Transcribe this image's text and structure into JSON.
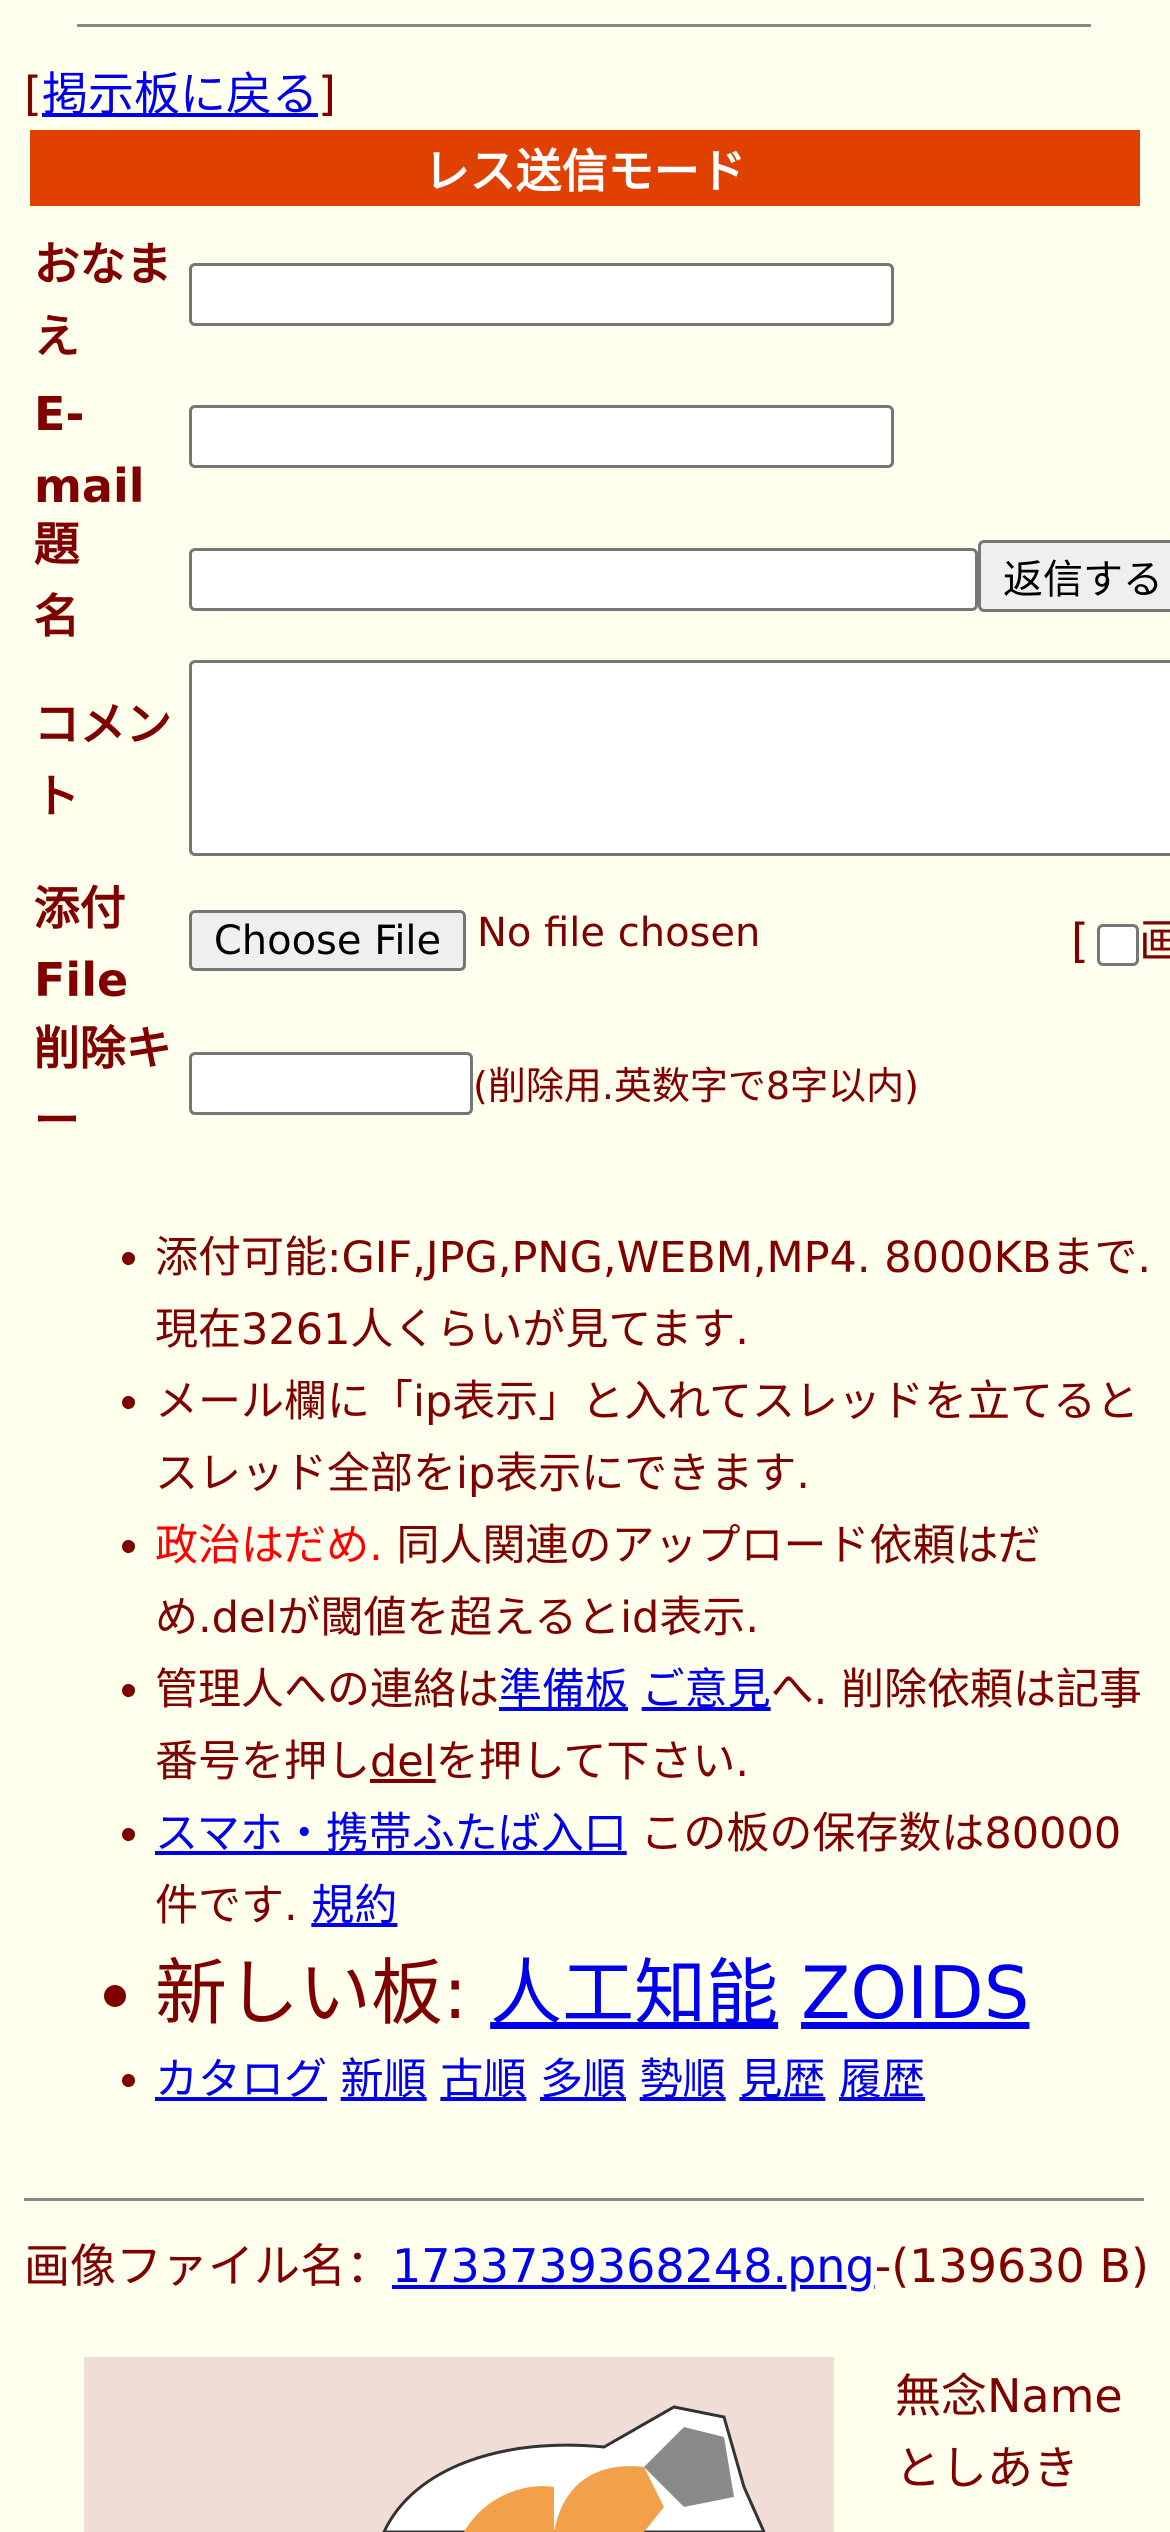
{
  "nav": {
    "back_open": "[",
    "back_link": "掲示板に戻る",
    "back_close": "]"
  },
  "mode_title": "レス送信モード",
  "form": {
    "name_label": "おなまえ",
    "email_label": "E-mail",
    "subject_label": "題名",
    "submit_label": "返信する",
    "comment_label": "コメント",
    "file_label": "添付File",
    "file_button": "Choose File",
    "file_status": "No file chosen",
    "checkbox_bracket": "[",
    "checkbox_partial": "画",
    "delkey_label": "削除キー",
    "delkey_hint": "(削除用.英数字で8字以内)"
  },
  "notes": {
    "n1": "添付可能:GIF,JPG,PNG,WEBM,MP4. 8000KBまで. 現在3261人くらいが見てます.",
    "n2": "メール欄に「ip表示」と入れてスレッドを立てるとスレッド全部をip表示にできます.",
    "n3_red": "政治はだめ.",
    "n3_rest": " 同人関連のアップロード依頼はだめ.delが閾値を超えるとid表示.",
    "n4_a": "管理人への連絡は",
    "n4_link1": "準備板",
    "n4_link2": "ご意見",
    "n4_b": "へ. 削除依頼は記事番号を押し",
    "n4_del": "del",
    "n4_c": "を押して下さい.",
    "n5_link": "スマホ・携帯ふたば入口",
    "n5_text": " この板の保存数は80000件です. ",
    "n5_terms": "規約",
    "n6_label": "新しい板: ",
    "n6_link1": "人工知能",
    "n6_link2": "ZOIDS",
    "sort_links": [
      "カタログ",
      "新順",
      "古順",
      "多順",
      "勢順",
      "見歴",
      "履歴"
    ]
  },
  "post": {
    "file_prefix": "画像ファイル名：",
    "file_name": "1733739368248.png",
    "file_size": "-(139630 B)",
    "name": "無念Name",
    "author": "としあき"
  },
  "colors": {
    "bg": "#ffffee",
    "text": "#800000",
    "mode_bar": "#e04000",
    "link": "#0000ee",
    "red": "#ff0000"
  }
}
